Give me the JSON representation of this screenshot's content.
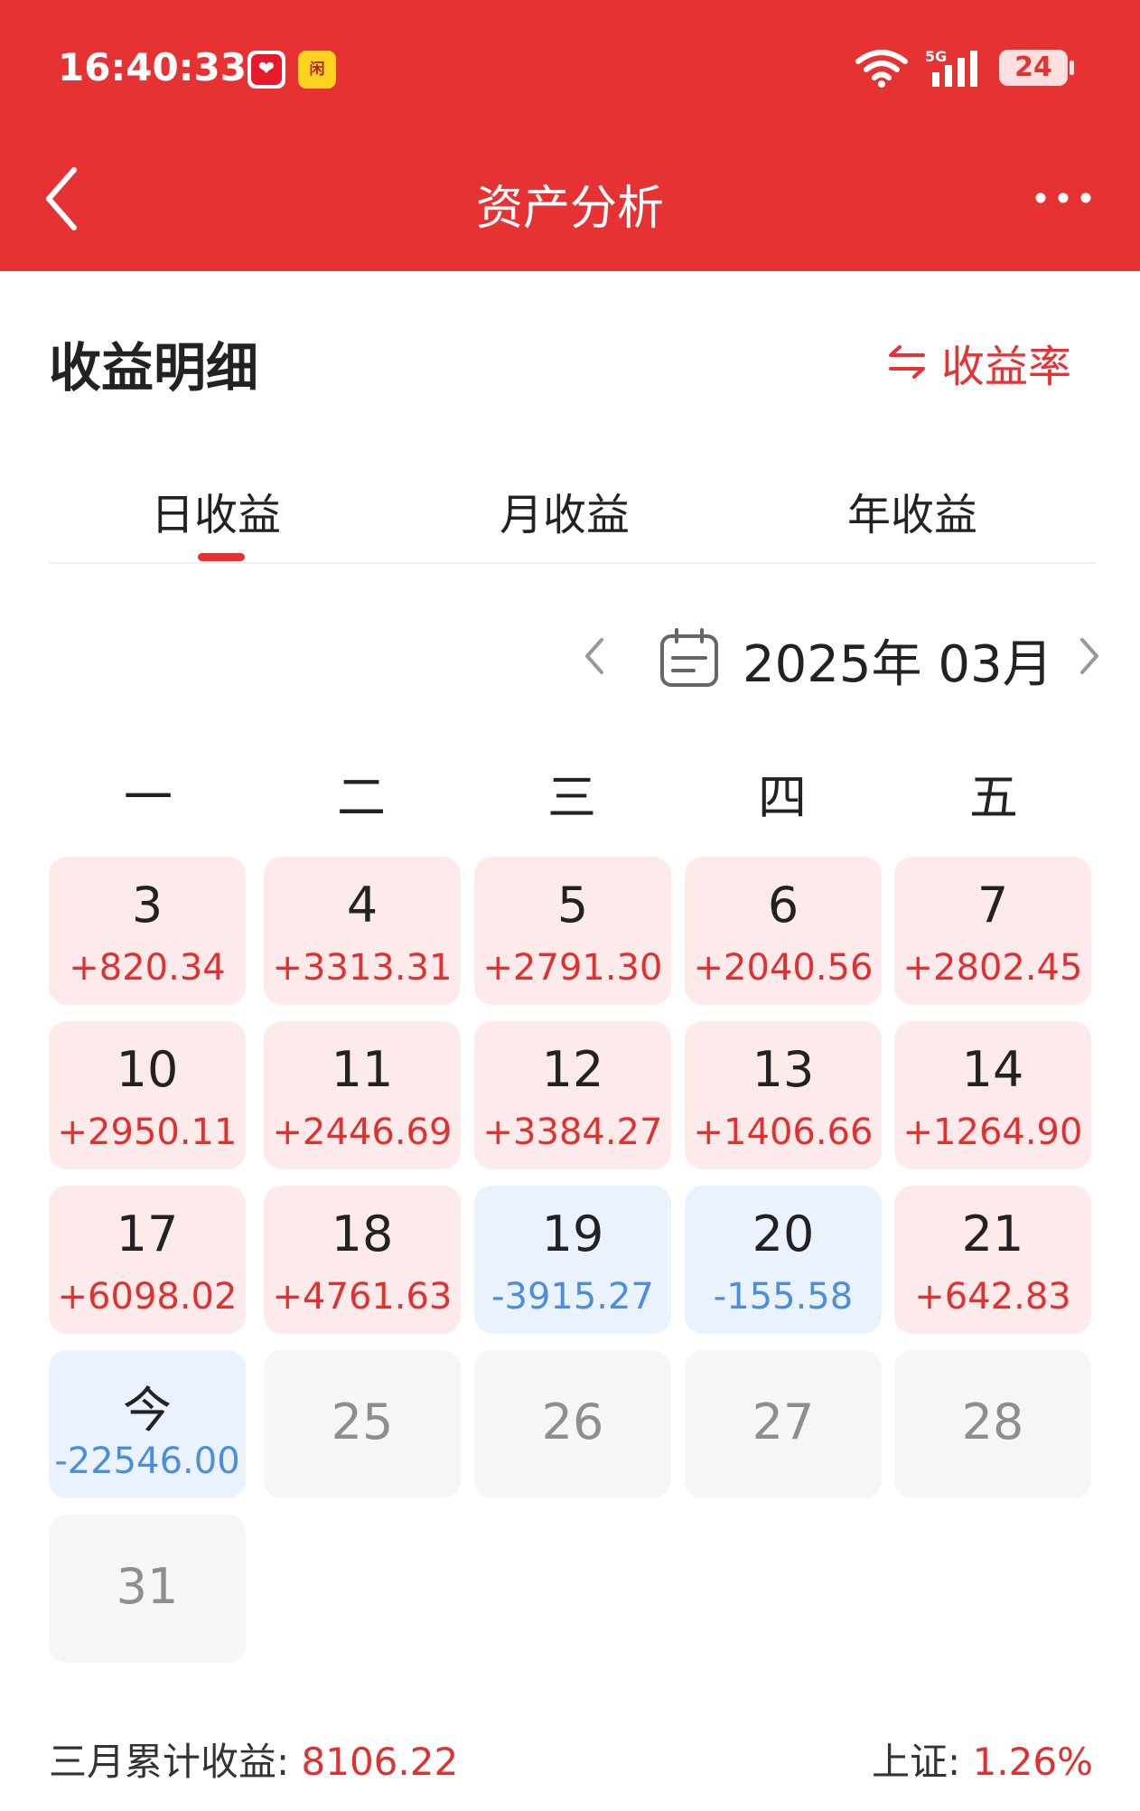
{
  "status_bar": {
    "time": "16:40:33",
    "network": "5G",
    "battery": "24"
  },
  "nav": {
    "title": "资产分析"
  },
  "section": {
    "title": "收益明细",
    "toggle_label": "收益率"
  },
  "tabs": [
    {
      "label": "日收益",
      "active": true
    },
    {
      "label": "月收益",
      "active": false
    },
    {
      "label": "年收益",
      "active": false
    }
  ],
  "month_picker": {
    "label": "2025年 03月"
  },
  "weekdays": [
    "一",
    "二",
    "三",
    "四",
    "五"
  ],
  "days": [
    {
      "day": "3",
      "value": "+820.34",
      "kind": "gain"
    },
    {
      "day": "4",
      "value": "+3313.31",
      "kind": "gain"
    },
    {
      "day": "5",
      "value": "+2791.30",
      "kind": "gain"
    },
    {
      "day": "6",
      "value": "+2040.56",
      "kind": "gain"
    },
    {
      "day": "7",
      "value": "+2802.45",
      "kind": "gain"
    },
    {
      "day": "10",
      "value": "+2950.11",
      "kind": "gain"
    },
    {
      "day": "11",
      "value": "+2446.69",
      "kind": "gain"
    },
    {
      "day": "12",
      "value": "+3384.27",
      "kind": "gain"
    },
    {
      "day": "13",
      "value": "+1406.66",
      "kind": "gain"
    },
    {
      "day": "14",
      "value": "+1264.90",
      "kind": "gain"
    },
    {
      "day": "17",
      "value": "+6098.02",
      "kind": "gain"
    },
    {
      "day": "18",
      "value": "+4761.63",
      "kind": "gain"
    },
    {
      "day": "19",
      "value": "-3915.27",
      "kind": "loss"
    },
    {
      "day": "20",
      "value": "-155.58",
      "kind": "loss"
    },
    {
      "day": "21",
      "value": "+642.83",
      "kind": "gain"
    },
    {
      "day": "今",
      "value": "-22546.00",
      "kind": "loss"
    },
    {
      "day": "25",
      "value": "",
      "kind": "future"
    },
    {
      "day": "26",
      "value": "",
      "kind": "future"
    },
    {
      "day": "27",
      "value": "",
      "kind": "future"
    },
    {
      "day": "28",
      "value": "",
      "kind": "future"
    },
    {
      "day": "31",
      "value": "",
      "kind": "future"
    }
  ],
  "footer": {
    "month_total_label": "三月累计收益: ",
    "month_total_value": "8106.22",
    "index_label": "上证: ",
    "index_value": "1.26%"
  },
  "colors": {
    "brand_red": "#e63232",
    "gain_red": "#e03131",
    "loss_blue": "#4d8de0"
  }
}
